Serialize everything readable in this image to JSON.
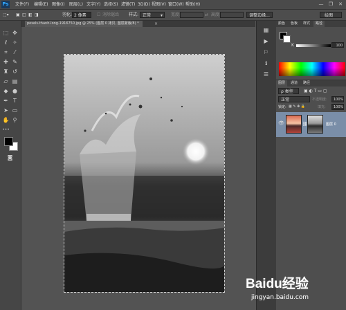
{
  "app": {
    "logo": "Ps"
  },
  "menu": [
    "文件(F)",
    "编辑(E)",
    "图像(I)",
    "图层(L)",
    "文字(Y)",
    "选择(S)",
    "滤镜(T)",
    "3D(D)",
    "视图(V)",
    "窗口(W)",
    "帮助(H)"
  ],
  "window_controls": {
    "minimize": "—",
    "restore": "❐",
    "close": "✕"
  },
  "options": {
    "feather_label": "羽化:",
    "feather_value": "2 像素",
    "antialias_label": "消除锯齿",
    "style_label": "样式:",
    "style_value": "正常",
    "width_label": "宽度:",
    "height_label": "高度:",
    "refine_edge": "调整边缘...",
    "workspace": "绘图"
  },
  "document": {
    "tab_title": "pexels-thanh-long-1916750.jpg @ 25% (图层 0 拷贝, 图层蒙版/8) *",
    "close": "×"
  },
  "color_panel": {
    "tabs": [
      "颜色",
      "色板",
      "样式",
      "路径"
    ],
    "channel_label": "K",
    "value": "100"
  },
  "layers_panel": {
    "tabs": [
      "图层",
      "通道",
      "路径"
    ],
    "kind_label": "ρ 类型",
    "blend_mode": "正常",
    "opacity_label": "不透明度:",
    "opacity_value": "100%",
    "lock_label": "锁定:",
    "fill_label": "填充:",
    "fill_value": "100%",
    "layer_name": "图层 0"
  },
  "watermark": {
    "brand": "Baidu经验",
    "url": "jingyan.baidu.com"
  },
  "colors": {
    "accent": "#31a8ff",
    "selected_layer": "#7a8ea8"
  }
}
